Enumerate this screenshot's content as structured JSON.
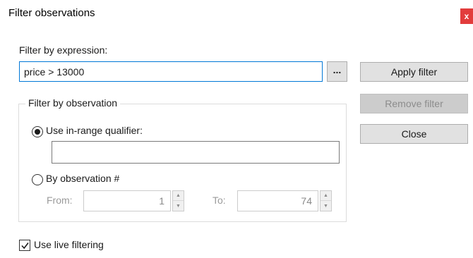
{
  "dialog": {
    "title": "Filter observations",
    "close_icon": "close-icon"
  },
  "expression": {
    "label": "Filter by expression:",
    "value": "price > 13000",
    "browse_label": "..."
  },
  "buttons": {
    "apply": "Apply filter",
    "remove": "Remove filter",
    "close": "Close"
  },
  "observation_group": {
    "title": "Filter by observation",
    "inrange": {
      "label": "Use in-range qualifier:",
      "checked": true,
      "value": ""
    },
    "by_obs": {
      "label": "By observation #",
      "checked": false,
      "from_label": "From:",
      "from_value": "1",
      "to_label": "To:",
      "to_value": "74"
    }
  },
  "live": {
    "label": "Use live filtering",
    "checked": true
  },
  "colors": {
    "close_button": "#e23c3c",
    "focus_border": "#0078d7"
  }
}
